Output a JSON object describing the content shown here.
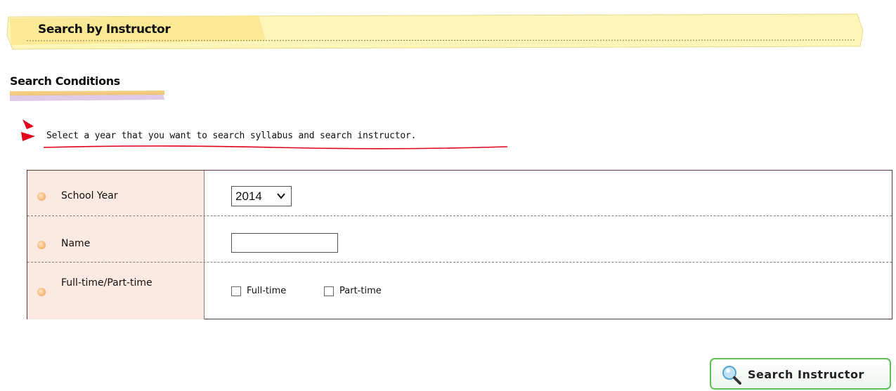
{
  "header": {
    "title": "Search by Instructor"
  },
  "section": {
    "title": "Search Conditions"
  },
  "instruction": {
    "text": "Select a year that you want to search syllabus and search instructor."
  },
  "form": {
    "rows": [
      {
        "label": "School Year"
      },
      {
        "label": "Name"
      },
      {
        "label": "Full-time/Part-time"
      }
    ],
    "school_year": {
      "selected": "2014"
    },
    "name": {
      "value": "",
      "placeholder": ""
    },
    "employment": {
      "options": [
        {
          "label": "Full-time",
          "checked": false
        },
        {
          "label": "Part-time",
          "checked": false
        }
      ]
    }
  },
  "actions": {
    "search_label": "Search Instructor"
  },
  "colors": {
    "banner_bg": "#fdf5b6",
    "label_bg": "#fbe9e2",
    "button_border": "#5fbf57",
    "accent_red": "#e2001a"
  }
}
